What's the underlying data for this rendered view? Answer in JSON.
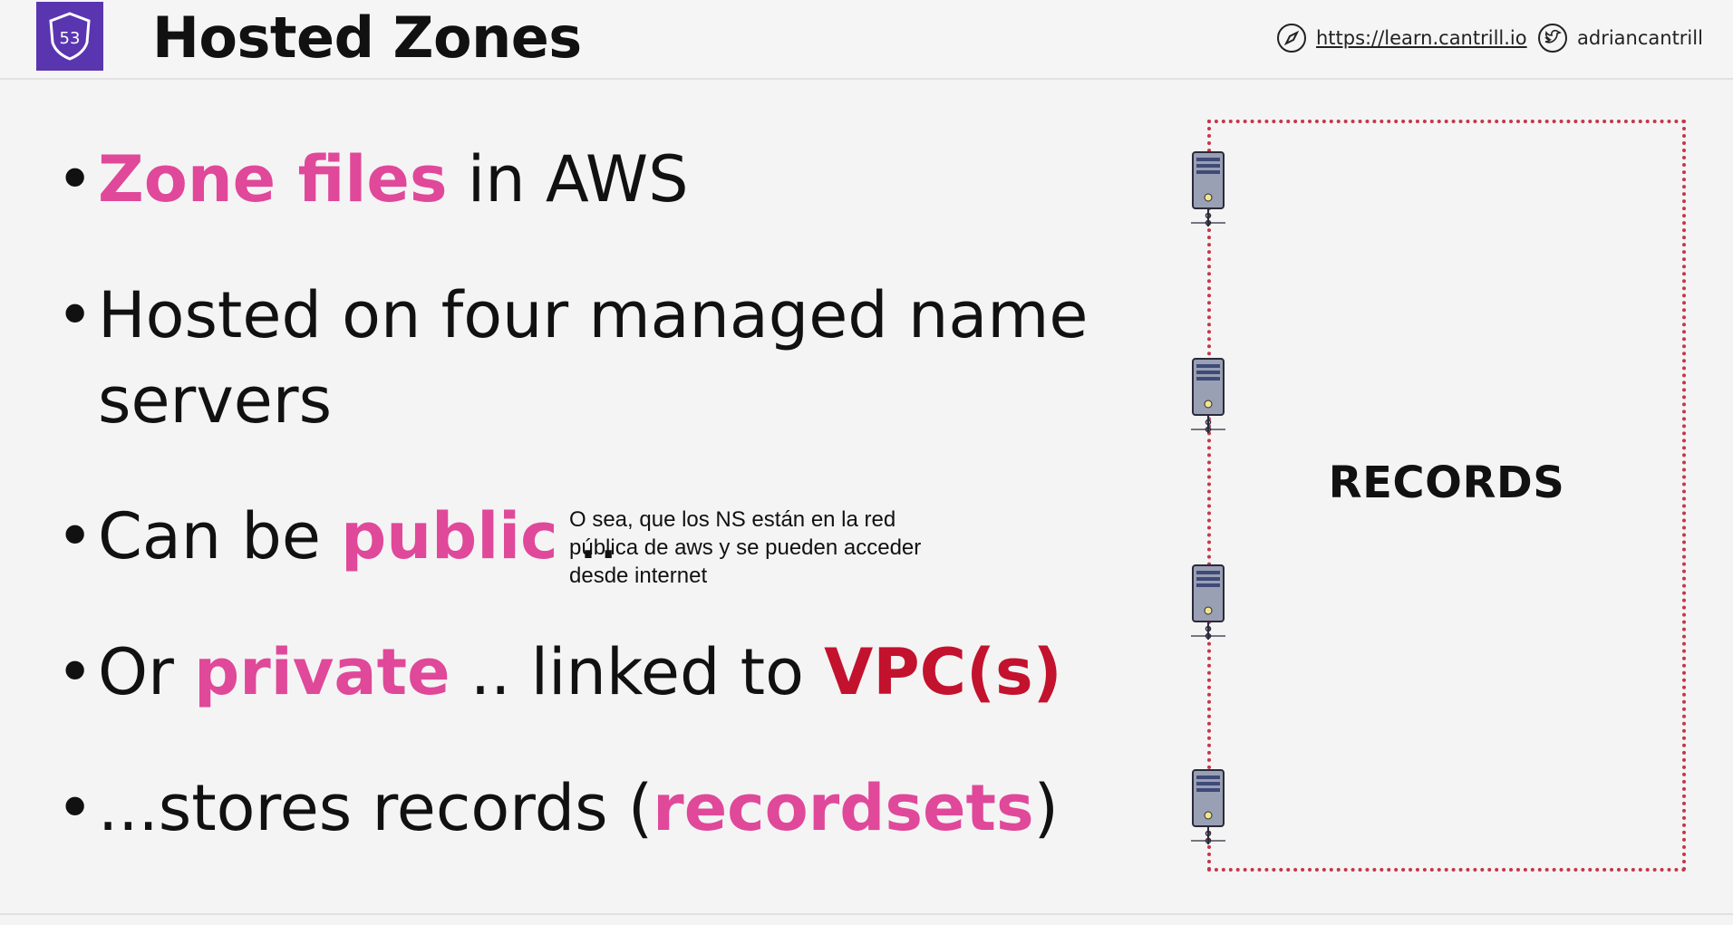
{
  "header": {
    "logo_text": "53",
    "title": "Hosted Zones",
    "url": "https://learn.cantrill.io",
    "twitter": "adriancantrill",
    "url_icon": "compass-icon",
    "twitter_icon": "twitter-bird-icon"
  },
  "bullets": {
    "b1": {
      "highlight": "Zone files",
      "rest": " in AWS"
    },
    "b2": {
      "line1": "Hosted on four managed name",
      "line2": "servers"
    },
    "b3": {
      "pre": "Can be ",
      "highlight": "public",
      "post": " .."
    },
    "b4": {
      "pre": "Or ",
      "highlight": "private",
      "mid": " .. linked to ",
      "red": "VPC(s)"
    },
    "b5": {
      "pre": "...stores records (",
      "highlight": "recordsets",
      "post": ")"
    }
  },
  "note": {
    "line1": "O sea, que los NS están en la red",
    "line2": "pública de aws y se pueden acceder",
    "line3": "desde internet"
  },
  "diagram": {
    "label": "RECORDS",
    "server_icon": "server-icon",
    "server_count": 4
  },
  "colors": {
    "accent_pink": "#e0489a",
    "accent_red": "#c3122e",
    "logo_purple": "#5a35b0",
    "box_border": "#c9344a"
  }
}
